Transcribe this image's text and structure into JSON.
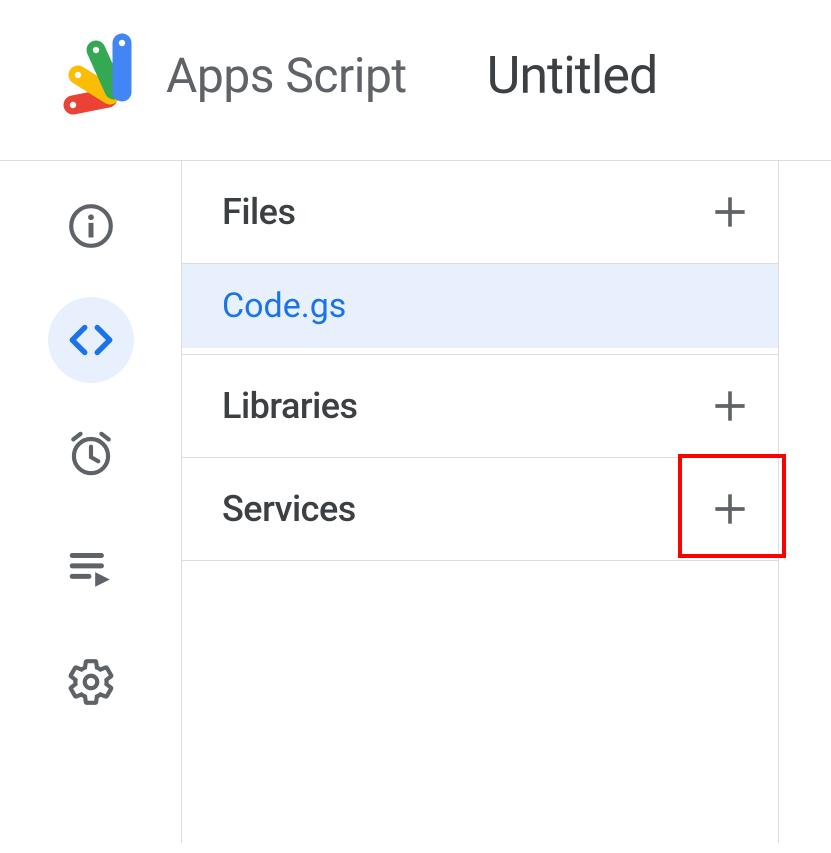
{
  "header": {
    "app_name": "Apps Script",
    "project_title": "Untitled"
  },
  "sidebar": {
    "files_label": "Files",
    "libraries_label": "Libraries",
    "services_label": "Services",
    "files": [
      {
        "name": "Code.gs"
      }
    ]
  }
}
